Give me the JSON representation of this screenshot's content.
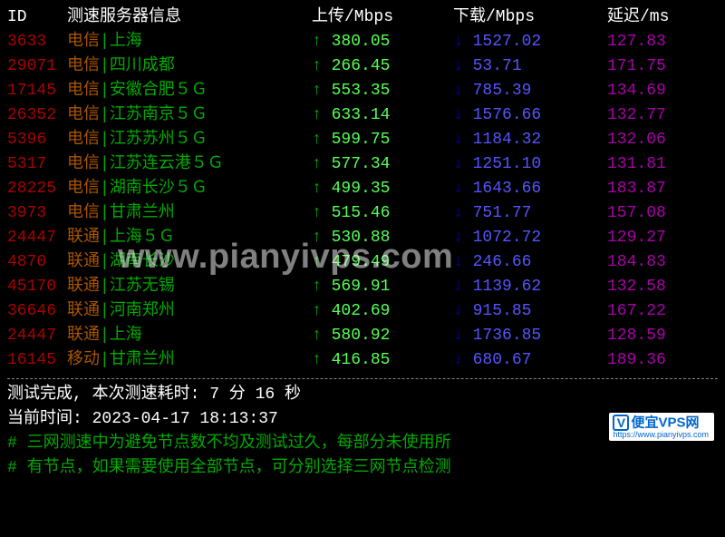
{
  "header": {
    "id": "ID",
    "server": "测速服务器信息",
    "upload": "上传/Mbps",
    "download": "下载/Mbps",
    "latency": "延迟/ms"
  },
  "rows": [
    {
      "id": "3633",
      "isp": "电信",
      "loc": "上海",
      "up": "380.05",
      "dn": "1527.02",
      "lat": "127.83"
    },
    {
      "id": "29071",
      "isp": "电信",
      "loc": "四川成都",
      "up": "266.45",
      "dn": "53.71",
      "lat": "171.75"
    },
    {
      "id": "17145",
      "isp": "电信",
      "loc": "安徽合肥５Ｇ",
      "up": "553.35",
      "dn": "785.39",
      "lat": "134.69"
    },
    {
      "id": "26352",
      "isp": "电信",
      "loc": "江苏南京５Ｇ",
      "up": "633.14",
      "dn": "1576.66",
      "lat": "132.77"
    },
    {
      "id": "5396",
      "isp": "电信",
      "loc": "江苏苏州５Ｇ",
      "up": "599.75",
      "dn": "1184.32",
      "lat": "132.06"
    },
    {
      "id": "5317",
      "isp": "电信",
      "loc": "江苏连云港５Ｇ",
      "up": "577.34",
      "dn": "1251.10",
      "lat": "131.81"
    },
    {
      "id": "28225",
      "isp": "电信",
      "loc": "湖南长沙５Ｇ",
      "up": "499.35",
      "dn": "1643.66",
      "lat": "183.87"
    },
    {
      "id": "3973",
      "isp": "电信",
      "loc": "甘肃兰州",
      "up": "515.46",
      "dn": "751.77",
      "lat": "157.08"
    },
    {
      "id": "24447",
      "isp": "联通",
      "loc": "上海５Ｇ",
      "up": "530.88",
      "dn": "1072.72",
      "lat": "129.27"
    },
    {
      "id": "4870",
      "isp": "联通",
      "loc": "湖南长沙",
      "up": "479.49",
      "dn": "246.66",
      "lat": "184.83"
    },
    {
      "id": "45170",
      "isp": "联通",
      "loc": "江苏无锡",
      "up": "569.91",
      "dn": "1139.62",
      "lat": "132.58"
    },
    {
      "id": "36646",
      "isp": "联通",
      "loc": "河南郑州",
      "up": "402.69",
      "dn": "915.85",
      "lat": "167.22"
    },
    {
      "id": "24447",
      "isp": "联通",
      "loc": "上海",
      "up": "580.92",
      "dn": "1736.85",
      "lat": "128.59"
    },
    {
      "id": "16145",
      "isp": "移动",
      "loc": "甘肃兰州",
      "up": "416.85",
      "dn": "680.67",
      "lat": "189.36"
    }
  ],
  "separator": "|",
  "arrows": {
    "up": "↑",
    "down": "↓"
  },
  "footer": {
    "complete": "测试完成, 本次测速耗时: 7 分 16 秒",
    "time": "当前时间: 2023-04-17 18:13:37",
    "comment1": "# 三网测速中为避免节点数不均及测试过久，每部分未使用所",
    "comment2": "# 有节点，如果需要使用全部节点，可分别选择三网节点检测"
  },
  "watermark": "www.pianyivps.com",
  "logo": {
    "icon": "V",
    "title": "便宜VPS网",
    "url": "https://www.pianyivps.com"
  }
}
